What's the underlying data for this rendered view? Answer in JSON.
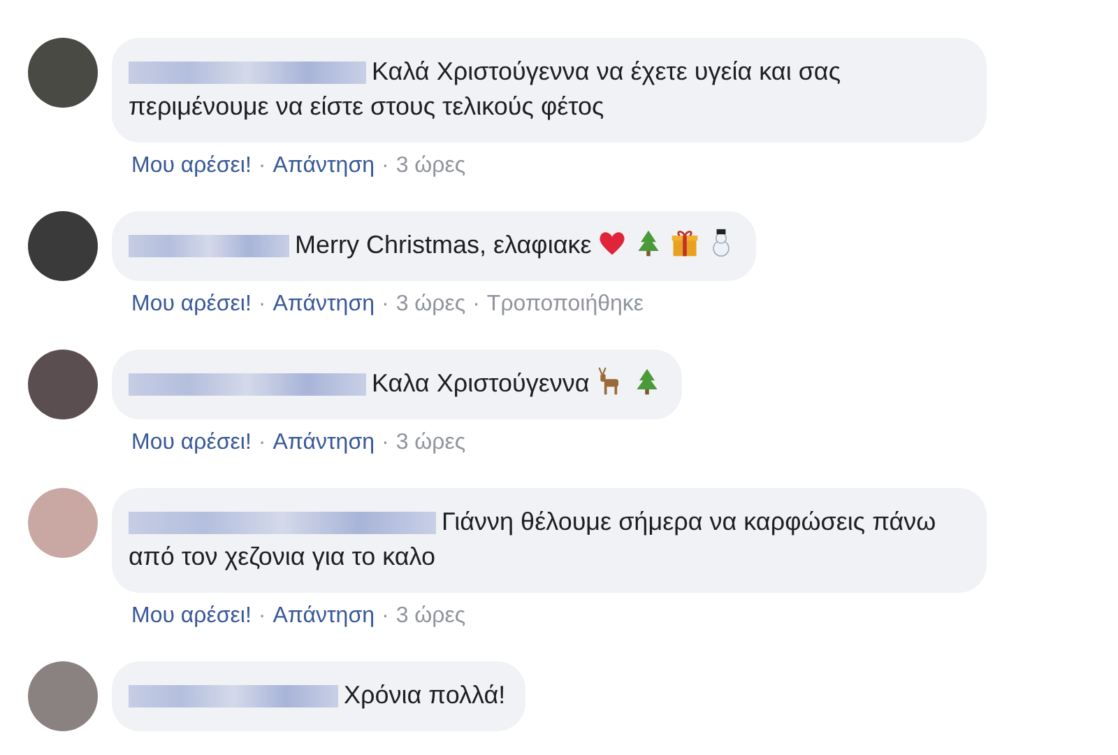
{
  "separator": "·",
  "comments": [
    {
      "text": "Καλά Χριστούγεννα να έχετε υγεία και σας περιμένουμε να είστε στους τελικούς φέτος",
      "actions": [
        {
          "label": "Μου αρέσει!",
          "kind": "link"
        },
        {
          "label": "Απάντηση",
          "kind": "link"
        },
        {
          "label": "3 ώρες",
          "kind": "meta"
        }
      ]
    },
    {
      "text": "Merry Christmas, ελαφιακε",
      "icons": [
        {
          "kind": "heart"
        },
        {
          "kind": "tree"
        },
        {
          "kind": "gift"
        },
        {
          "kind": "snowman"
        }
      ],
      "actions": [
        {
          "label": "Μου αρέσει!",
          "kind": "link"
        },
        {
          "label": "Απάντηση",
          "kind": "link"
        },
        {
          "label": "3 ώρες",
          "kind": "meta"
        },
        {
          "label": "Τροποποιήθηκε",
          "kind": "meta"
        }
      ]
    },
    {
      "text": "Καλα Χριστούγεννα",
      "icons": [
        {
          "kind": "deer"
        },
        {
          "kind": "tree"
        }
      ],
      "actions": [
        {
          "label": "Μου αρέσει!",
          "kind": "link"
        },
        {
          "label": "Απάντηση",
          "kind": "link"
        },
        {
          "label": "3 ώρες",
          "kind": "meta"
        }
      ]
    },
    {
      "text": "Γιάννη θέλουμε σήμερα να καρφώσεις πάνω από τον χεζονια για το καλο",
      "actions": [
        {
          "label": "Μου αρέσει!",
          "kind": "link"
        },
        {
          "label": "Απάντηση",
          "kind": "link"
        },
        {
          "label": "3 ώρες",
          "kind": "meta"
        }
      ]
    },
    {
      "text": "Χρόνια πολλά!"
    }
  ]
}
